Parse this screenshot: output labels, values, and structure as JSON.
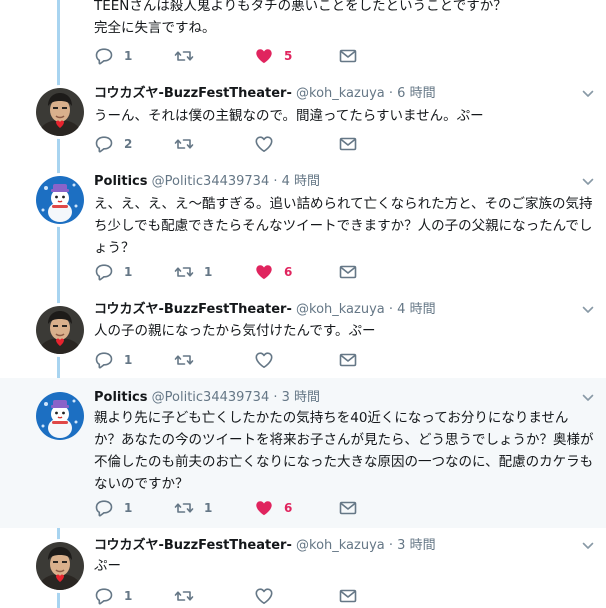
{
  "icons": {
    "reply": "reply-icon",
    "retweet": "retweet-icon",
    "like": "heart-icon",
    "dm": "envelope-icon",
    "more": "chevron-down-icon"
  },
  "colors": {
    "thread_line": "#a8d4f0",
    "like": "#e0245e",
    "secondary": "#657786",
    "highlight_bg": "#f5f8fa"
  },
  "tweet0": {
    "text": "TEENさんは殺人鬼よりもタチの悪いことをしたということですか？\n完全に失言ですね。",
    "reply_count": "1",
    "retweet_count": "",
    "like_count": "5",
    "liked": true
  },
  "tweet1": {
    "name": "コウカズヤ-BuzzFestTheater-",
    "handle": "@koh_kazuya",
    "time": "6 時間",
    "text": "うーん、それは僕の主観なので。間違ってたらすいません。ぷー",
    "reply_count": "2",
    "retweet_count": "",
    "like_count": "",
    "liked": false
  },
  "tweet2": {
    "name": "Politics",
    "handle": "@Politic34439734",
    "time": "4 時間",
    "text": "え、え、え、え～酷すぎる。追い詰められて亡くなられた方と、そのご家族の気持ち少しでも配慮できたらそんなツイートできますか？人の子の父親になったんでしょう？",
    "reply_count": "1",
    "retweet_count": "1",
    "like_count": "6",
    "liked": true
  },
  "tweet3": {
    "name": "コウカズヤ-BuzzFestTheater-",
    "handle": "@koh_kazuya",
    "time": "4 時間",
    "text": "人の子の親になったから気付けたんです。ぷー",
    "reply_count": "1",
    "retweet_count": "",
    "like_count": "",
    "liked": false
  },
  "tweet4": {
    "name": "Politics",
    "handle": "@Politic34439734",
    "time": "3 時間",
    "text": "親より先に子ども亡くしたかたの気持ちを40近くになってお分りになりませんか？あなたの今のツイートを将来お子さんが見たら、どう思うでしょうか？奥様が不倫したのも前夫のお亡くなりになった大きな原因の一つなのに、配慮のカケラもないのですか？",
    "reply_count": "1",
    "retweet_count": "1",
    "like_count": "6",
    "liked": true
  },
  "tweet5": {
    "name": "コウカズヤ-BuzzFestTheater-",
    "handle": "@koh_kazuya",
    "time": "3 時間",
    "text": "ぷー",
    "reply_count": "1",
    "retweet_count": "",
    "like_count": "",
    "liked": false
  }
}
